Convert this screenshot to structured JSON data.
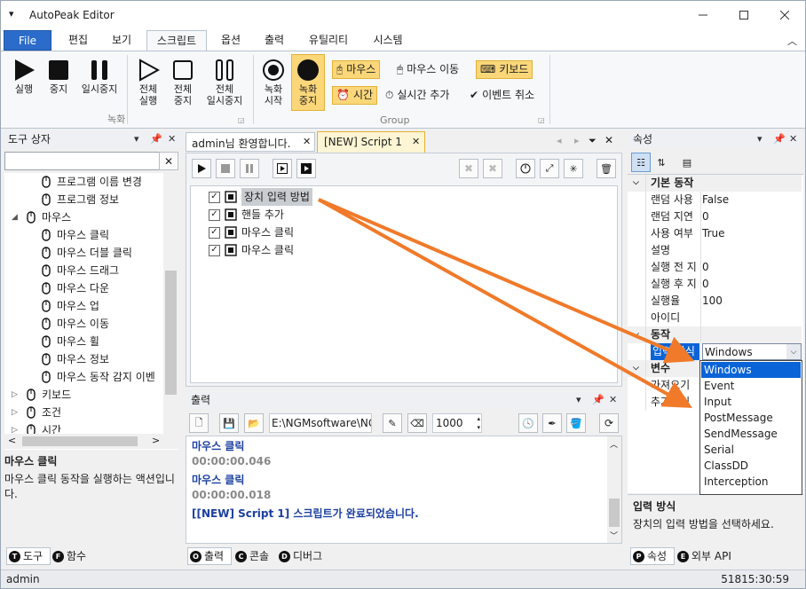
{
  "window": {
    "title": "AutoPeak Editor",
    "menu_glyph": "▾"
  },
  "ribbon_tabs": [
    "File",
    "편집",
    "보기",
    "스크립트",
    "옵션",
    "출력",
    "유틸리티",
    "시스템"
  ],
  "ribbon": {
    "run": "실행",
    "stop": "중지",
    "pause": "일시중지",
    "run_all": [
      "전체",
      "실행"
    ],
    "stop_all": [
      "전체",
      "중지"
    ],
    "pause_all": [
      "전체",
      "일시중지"
    ],
    "rec_start": [
      "녹화",
      "시작"
    ],
    "rec_stop": [
      "녹화",
      "중지"
    ],
    "group_record": "녹화",
    "group_group": "Group",
    "mouse": "마우스",
    "mouse_move": "마우스 이동",
    "keyboard": "키보드",
    "time": "시간",
    "realtime_add": "실시간 추가",
    "event_cancel": "이벤트 취소"
  },
  "toolbox": {
    "title": "도구 상자",
    "search_value": "",
    "items": [
      {
        "label": "프로그램 이름 변경",
        "level": 2,
        "icon": "rename-icon"
      },
      {
        "label": "프로그램 정보",
        "level": 2,
        "icon": "info-icon"
      },
      {
        "label": "마우스",
        "level": 1,
        "icon": "mouse-icon",
        "expander": "◢"
      },
      {
        "label": "마우스 클릭",
        "level": 2,
        "icon": "mouse-click-icon"
      },
      {
        "label": "마우스 더블 클릭",
        "level": 2,
        "icon": "mouse-double-click-icon"
      },
      {
        "label": "마우스 드래그",
        "level": 2,
        "icon": "mouse-drag-icon"
      },
      {
        "label": "마우스 다운",
        "level": 2,
        "icon": "mouse-down-icon"
      },
      {
        "label": "마우스 업",
        "level": 2,
        "icon": "mouse-up-icon"
      },
      {
        "label": "마우스 이동",
        "level": 2,
        "icon": "mouse-move-icon"
      },
      {
        "label": "마우스 휠",
        "level": 2,
        "icon": "mouse-wheel-icon"
      },
      {
        "label": "마우스 정보",
        "level": 2,
        "icon": "mouse-info-icon"
      },
      {
        "label": "마우스 동작 감지 이벤",
        "level": 2,
        "icon": "lightning-icon"
      },
      {
        "label": "키보드",
        "level": 1,
        "icon": "keyboard-icon",
        "expander": "▷"
      },
      {
        "label": "조건",
        "level": 1,
        "icon": "condition-icon",
        "expander": "▷"
      },
      {
        "label": "시간",
        "level": 1,
        "icon": "calendar-icon",
        "expander": "▷"
      }
    ],
    "desc_title": "마우스 클릭",
    "desc_text": "마우스 클릭 동작을 실행하는 액션입니다.",
    "tabs": [
      {
        "letter": "T",
        "label": "도구"
      },
      {
        "letter": "F",
        "label": "함수"
      }
    ]
  },
  "doc_tabs": [
    {
      "label": "admin님 환영합니다."
    },
    {
      "label": "[NEW] Script 1"
    }
  ],
  "script": {
    "items": [
      {
        "label": "장치 입력 방법",
        "icon": "device-input-icon",
        "checked": true,
        "selected": true
      },
      {
        "label": "핸들 추가",
        "icon": "crosshair-icon",
        "checked": true,
        "selected": false
      },
      {
        "label": "마우스 클릭",
        "icon": "mouse-click-icon",
        "checked": true,
        "selected": false
      },
      {
        "label": "마우스 클릭",
        "icon": "mouse-click-icon",
        "checked": true,
        "selected": false
      }
    ]
  },
  "output": {
    "title": "출력",
    "path": "E:\\NGMsoftware\\NG",
    "interval": "1000",
    "lines": [
      {
        "text": "마우스 클릭",
        "kind": "action"
      },
      {
        "text": "00:00:00.046",
        "kind": "time"
      },
      {
        "text": "마우스 클릭",
        "kind": "action"
      },
      {
        "text": "00:00:00.018",
        "kind": "time"
      },
      {
        "text": "[[NEW] Script 1] 스크립트가 완료되었습니다.",
        "kind": "action"
      }
    ],
    "tabs": [
      {
        "letter": "O",
        "label": "출력"
      },
      {
        "letter": "C",
        "label": "콘솔"
      },
      {
        "letter": "D",
        "label": "디버그"
      }
    ]
  },
  "properties": {
    "title": "속성",
    "cat_basic": "기본 동작",
    "basic": [
      {
        "k": "랜덤 사용",
        "v": "False"
      },
      {
        "k": "랜덤 지연",
        "v": "0"
      },
      {
        "k": "사용 여부",
        "v": "True"
      },
      {
        "k": "설명",
        "v": ""
      },
      {
        "k": "실행 전 지",
        "v": "0"
      },
      {
        "k": "실행 후 지",
        "v": "0"
      },
      {
        "k": "실행율",
        "v": "100"
      },
      {
        "k": "아이디",
        "v": ""
      }
    ],
    "cat_action": "동작",
    "input_key": "입력 방식",
    "input_value": "Windows",
    "cat_var": "변수",
    "var_items": [
      "가져오기",
      "추가하기"
    ],
    "dropdown": [
      "Windows",
      "Event",
      "Input",
      "PostMessage",
      "SendMessage",
      "Serial",
      "ClassDD",
      "Interception"
    ],
    "dropdown_selected": "Windows",
    "desc_title": "입력 방식",
    "desc_text": "장치의 입력 방법을 선택하세요.",
    "tabs": [
      {
        "letter": "P",
        "label": "속성"
      },
      {
        "letter": "E",
        "label": "외부 API"
      }
    ]
  },
  "status": {
    "user": "admin",
    "clock": "51815:30:59"
  },
  "colors": {
    "accent": "#2b6bc9",
    "selection": "#fbd77a",
    "arrow": "#f07a2a",
    "dropdown_sel": "#0a64d8"
  }
}
